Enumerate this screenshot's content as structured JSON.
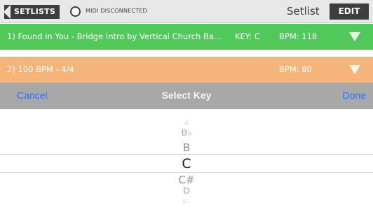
{
  "topbar": {
    "back_label": "SETLISTS",
    "midi_status": "MIDI DISCONNECTED",
    "title": "Setlist",
    "edit_label": "EDIT"
  },
  "songs": [
    {
      "title": "1) Found in You - Bridge Intro by Vertical Church Ba...",
      "key": "KEY: C",
      "bpm": "BPM: 118",
      "color": "#50c85a"
    },
    {
      "title": "2) 100 BPM - 4/4",
      "key": "",
      "bpm": "BPM: 80",
      "color": "#f4b47a"
    }
  ],
  "picker": {
    "cancel_label": "Cancel",
    "title": "Select Key",
    "done_label": "Done",
    "options": [
      "A",
      "B♭",
      "B",
      "C",
      "C#",
      "D",
      "E♭"
    ],
    "selected": "C"
  }
}
